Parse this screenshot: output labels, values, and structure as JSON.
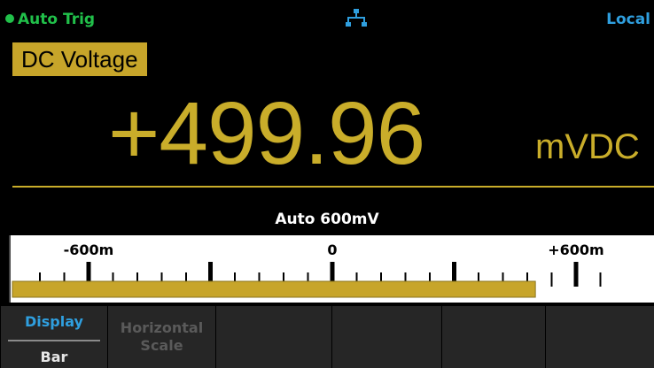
{
  "status": {
    "trigger": "Auto Trig",
    "trigger_color": "#21c04a",
    "network_icon": "lan-network-icon",
    "remote_state": "Local",
    "remote_color": "#2f9fdf"
  },
  "measurement": {
    "function": "DC Voltage",
    "value": "+499.96",
    "units": "mVDC",
    "accent_color": "#c9ad2a"
  },
  "bar_display": {
    "range_label": "Auto 600mV",
    "tick_labels": [
      "-600m",
      "0",
      "+600m"
    ],
    "scale_min": -600,
    "scale_max": 600,
    "value": 499.96,
    "fill_color": "#c7a52a"
  },
  "softkeys": {
    "display_label": "Display",
    "display_value": "Bar",
    "horizontal_scale_line1": "Horizontal",
    "horizontal_scale_line2": "Scale"
  }
}
